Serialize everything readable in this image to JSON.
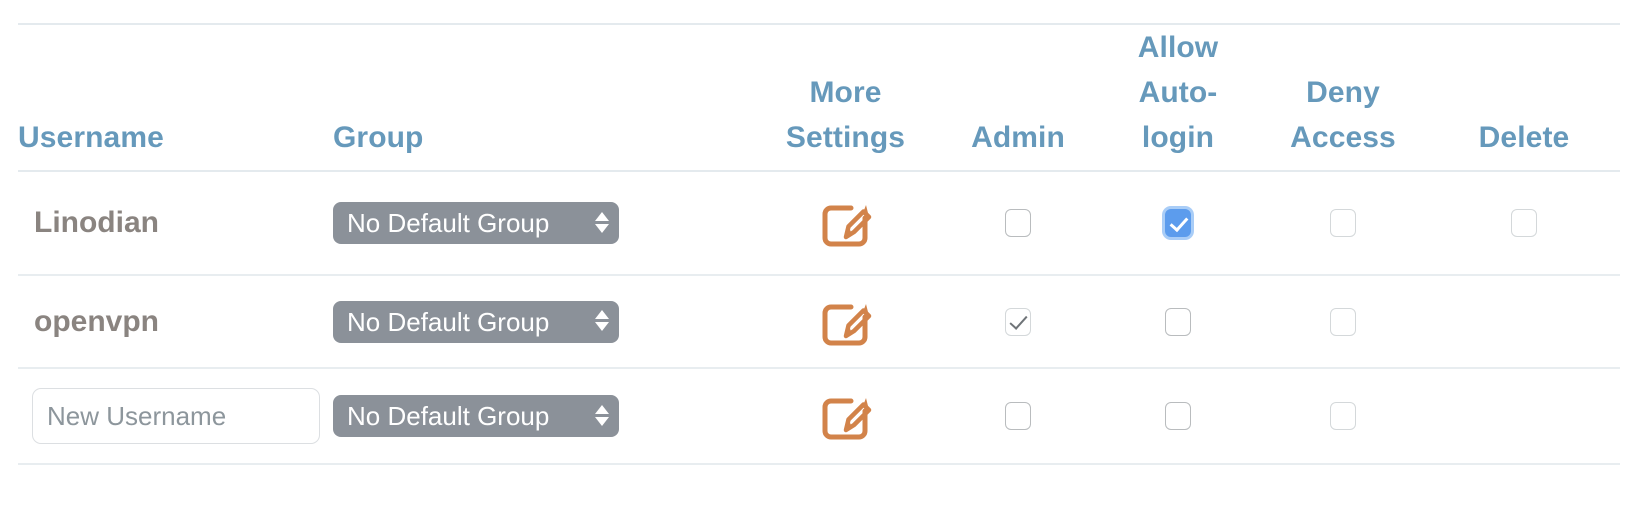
{
  "table": {
    "columns": [
      {
        "key": "username",
        "label": "Username",
        "align": "left"
      },
      {
        "key": "group",
        "label": "Group",
        "align": "left"
      },
      {
        "key": "more_settings",
        "label_line1": "More",
        "label_line2": "Settings",
        "align": "center"
      },
      {
        "key": "admin",
        "label": "Admin",
        "align": "center"
      },
      {
        "key": "allow_autologin",
        "label_line1": "Allow",
        "label_line2": "Auto-",
        "label_line3": "login",
        "align": "center"
      },
      {
        "key": "deny_access",
        "label_line1": "Deny",
        "label_line2": "Access",
        "align": "center"
      },
      {
        "key": "delete",
        "label": "Delete",
        "align": "center"
      }
    ],
    "rows": [
      {
        "username": "Linodian",
        "username_is_input": false,
        "group_selected": "No Default Group",
        "more_settings_icon": "edit-pencil-square-icon",
        "admin_checked": false,
        "admin_state": "unchecked",
        "autologin_checked": true,
        "autologin_state": "checked-focused",
        "deny_access_checked": false,
        "deny_access_state": "unchecked",
        "delete_present": true,
        "delete_checked": false
      },
      {
        "username": "openvpn",
        "username_is_input": false,
        "group_selected": "No Default Group",
        "more_settings_icon": "edit-pencil-square-icon",
        "admin_checked": true,
        "admin_state": "checked-disabled",
        "autologin_checked": false,
        "autologin_state": "unchecked",
        "deny_access_checked": false,
        "deny_access_state": "unchecked",
        "delete_present": false,
        "delete_checked": false
      },
      {
        "username": "",
        "username_is_input": true,
        "username_placeholder": "New Username",
        "group_selected": "No Default Group",
        "more_settings_icon": "edit-pencil-square-icon",
        "admin_checked": false,
        "admin_state": "unchecked",
        "autologin_checked": false,
        "autologin_state": "unchecked",
        "deny_access_checked": false,
        "deny_access_state": "unchecked",
        "delete_present": false,
        "delete_checked": false
      }
    ]
  },
  "colors": {
    "header_text": "#6699bb",
    "username_text": "#8a8480",
    "select_background": "#8b9199",
    "select_text": "#ffffff",
    "icon_orange": "#d2834a",
    "checkbox_border": "#b9bcbe",
    "checkbox_checked_blue": "#5c9ced",
    "checkbox_focus_ring": "#a9cdf7",
    "row_divider": "#e8edf0",
    "page_background": "#ffffff"
  }
}
